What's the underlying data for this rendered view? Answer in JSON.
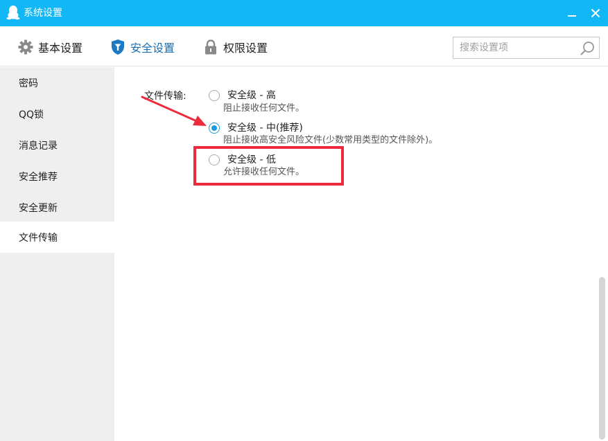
{
  "window": {
    "title": "系统设置",
    "logo_icon": "qq-penguin-icon",
    "minimize_icon": "minimize-icon",
    "close_icon": "close-icon",
    "title_bar_color": "#12b7f5"
  },
  "toolbar": {
    "tabs": [
      {
        "label": "基本设置",
        "icon": "gear-icon",
        "active": false
      },
      {
        "label": "安全设置",
        "icon": "shield-icon",
        "active": true
      },
      {
        "label": "权限设置",
        "icon": "lock-icon",
        "active": false
      }
    ],
    "search": {
      "placeholder": "搜索设置项",
      "value": "",
      "icon": "search-icon"
    }
  },
  "sidebar": {
    "items": [
      {
        "label": "密码",
        "active": false
      },
      {
        "label": "QQ锁",
        "active": false
      },
      {
        "label": "消息记录",
        "active": false
      },
      {
        "label": "安全推荐",
        "active": false
      },
      {
        "label": "安全更新",
        "active": false
      },
      {
        "label": "文件传输",
        "active": true
      }
    ]
  },
  "content": {
    "field_label": "文件传输:",
    "options": [
      {
        "title": "安全级 - 高",
        "desc": "阻止接收任何文件。",
        "checked": false
      },
      {
        "title": "安全级 - 中(推荐)",
        "desc": "阻止接收高安全风险文件(少数常用类型的文件除外)。",
        "checked": true
      },
      {
        "title": "安全级 - 低",
        "desc": "允许接收任何文件。",
        "checked": false
      }
    ]
  },
  "annotations": {
    "arrow_color": "#ee2a3d",
    "highlight_color": "#ee2a3d"
  },
  "colors": {
    "accent": "#1d9be0",
    "active_tab_text": "#1a6fb0",
    "sidebar_bg": "#efefef"
  }
}
